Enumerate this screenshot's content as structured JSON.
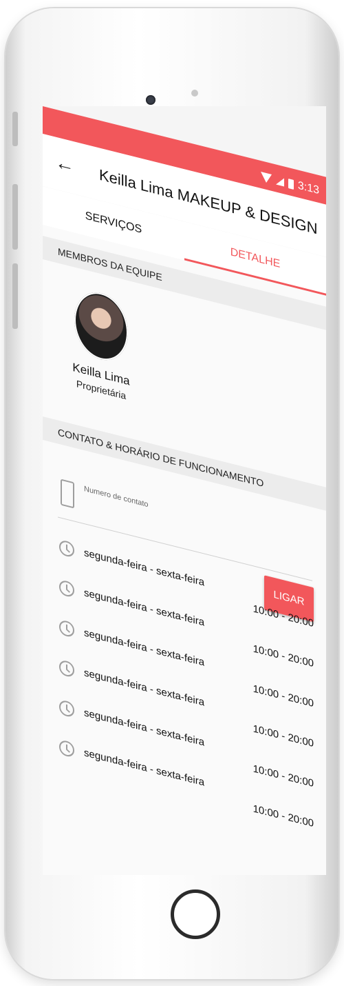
{
  "status": {
    "time": "3:13"
  },
  "appbar": {
    "title": "Keilla Lima MAKEUP & DESIGN"
  },
  "tabs": [
    {
      "label": "SERVIÇOS"
    },
    {
      "label": "DETALHE"
    }
  ],
  "team": {
    "header": "MEMBROS DA EQUIPE",
    "member": {
      "name": "Keilla Lima",
      "role": "Proprietária"
    }
  },
  "contact": {
    "header": "CONTATO & HORÁRIO DE FUNCIONAMENTO",
    "phone_label": "Numero de contato",
    "call_label": "LIGAR"
  },
  "hours": [
    {
      "day": "segunda-feira - sexta-feira",
      "time": "10:00 - 20:00"
    },
    {
      "day": "segunda-feira - sexta-feira",
      "time": "10:00 - 20:00"
    },
    {
      "day": "segunda-feira - sexta-feira",
      "time": "10:00 - 20:00"
    },
    {
      "day": "segunda-feira - sexta-feira",
      "time": "10:00 - 20:00"
    },
    {
      "day": "segunda-feira - sexta-feira",
      "time": "10:00 - 20:00"
    },
    {
      "day": "segunda-feira - sexta-feira",
      "time": "10:00 - 20:00"
    }
  ],
  "colors": {
    "accent": "#f2575b"
  }
}
